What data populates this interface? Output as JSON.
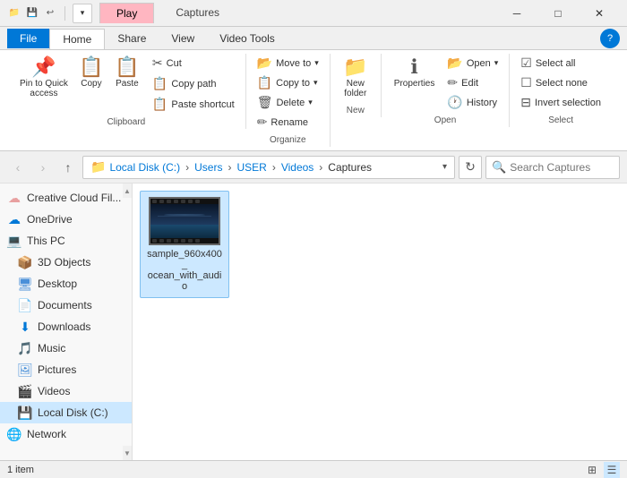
{
  "titlebar": {
    "icons": [
      "📁",
      "💾",
      "↩"
    ],
    "tab_play": "Play",
    "tab_title": "Captures",
    "win_min": "─",
    "win_max": "□",
    "win_close": "✕"
  },
  "ribbon_tabs": {
    "file": "File",
    "home": "Home",
    "share": "Share",
    "view": "View",
    "video_tools": "Video Tools"
  },
  "ribbon": {
    "clipboard": {
      "label": "Clipboard",
      "pin_label": "Pin to Quick\naccess",
      "copy_label": "Copy",
      "paste_label": "Paste",
      "cut": "Cut",
      "copy_path": "Copy path",
      "paste_shortcut": "Paste shortcut"
    },
    "organize": {
      "label": "Organize",
      "move_to": "Move to",
      "copy_to": "Copy to",
      "delete": "Delete",
      "rename": "Rename"
    },
    "new": {
      "label": "New",
      "new_folder": "New\nfolder"
    },
    "open": {
      "label": "Open",
      "open": "Open",
      "edit": "Edit",
      "history": "History",
      "properties": "Properties"
    },
    "select": {
      "label": "Select",
      "select_all": "Select all",
      "select_none": "Select none",
      "invert_selection": "Invert selection"
    }
  },
  "toolbar": {
    "back": "‹",
    "forward": "›",
    "up": "↑",
    "address": {
      "local_disk": "Local Disk (C:)",
      "users": "Users",
      "user": "USER",
      "videos": "Videos",
      "captures": "Captures"
    },
    "refresh": "↻",
    "search_placeholder": "Search Captures"
  },
  "sidebar": {
    "items": [
      {
        "icon": "☁",
        "label": "Creative Cloud Fil...",
        "indent": 0,
        "color": "#e8a0a0"
      },
      {
        "icon": "☁",
        "label": "OneDrive",
        "indent": 0,
        "color": "#0078d7"
      },
      {
        "icon": "💻",
        "label": "This PC",
        "indent": 0,
        "color": "#555"
      },
      {
        "icon": "📦",
        "label": "3D Objects",
        "indent": 1,
        "color": "#555"
      },
      {
        "icon": "🖥",
        "label": "Desktop",
        "indent": 1,
        "color": "#555"
      },
      {
        "icon": "📄",
        "label": "Documents",
        "indent": 1,
        "color": "#555"
      },
      {
        "icon": "⬇",
        "label": "Downloads",
        "indent": 1,
        "color": "#0078d7"
      },
      {
        "icon": "🎵",
        "label": "Music",
        "indent": 1,
        "color": "#555"
      },
      {
        "icon": "🖼",
        "label": "Pictures",
        "indent": 1,
        "color": "#555"
      },
      {
        "icon": "🎬",
        "label": "Videos",
        "indent": 1,
        "color": "#555"
      },
      {
        "icon": "💾",
        "label": "Local Disk (C:)",
        "indent": 1,
        "color": "#555",
        "selected": true
      },
      {
        "icon": "🌐",
        "label": "Network",
        "indent": 0,
        "color": "#555"
      }
    ]
  },
  "files": [
    {
      "name": "sample_960x400_\nocean_with_audi\no",
      "type": "video",
      "selected": true
    }
  ],
  "statusbar": {
    "count": "1 item"
  }
}
